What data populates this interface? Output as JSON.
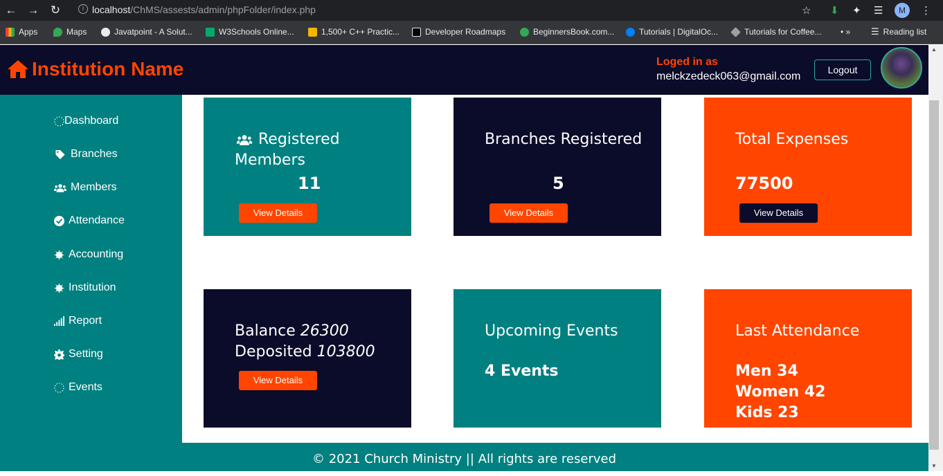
{
  "browser": {
    "url_host": "localhost",
    "url_path": "/ChMS/assests/admin/phpFolder/index.php",
    "reading_list": "Reading list",
    "profile_initial": "M",
    "bookmarks": [
      {
        "label": "Apps",
        "color": "#e8453c"
      },
      {
        "label": "Maps",
        "color": "#34a853"
      },
      {
        "label": "Javatpoint - A Solut...",
        "color": "#e8eaed"
      },
      {
        "label": "W3Schools Online...",
        "color": "#04aa6d"
      },
      {
        "label": "1,500+ C++ Practic...",
        "color": "#f4b400"
      },
      {
        "label": "Developer Roadmaps",
        "color": "#000000"
      },
      {
        "label": "BeginnersBook.com...",
        "color": "#34a853"
      },
      {
        "label": "Tutorials | DigitalOc...",
        "color": "#0080ff"
      },
      {
        "label": "Tutorials for Coffee...",
        "color": "#9aa0a6"
      }
    ]
  },
  "header": {
    "brand": "Institution Name",
    "logged_label": "Loged in as",
    "email": "melckzedeck063@gmail.com",
    "logout": "Logout"
  },
  "sidebar": {
    "items": [
      {
        "label": "Dashboard",
        "icon": "spinner-icon"
      },
      {
        "label": "Branches",
        "icon": "tags-icon"
      },
      {
        "label": "Members",
        "icon": "users-icon"
      },
      {
        "label": "Attendance",
        "icon": "check-circle-icon"
      },
      {
        "label": "Accounting",
        "icon": "sun-icon"
      },
      {
        "label": "Institution",
        "icon": "sun-icon"
      },
      {
        "label": "Report",
        "icon": "signal-icon"
      },
      {
        "label": "Setting",
        "icon": "gear-icon"
      },
      {
        "label": "Events",
        "icon": "spinner-icon"
      }
    ]
  },
  "cards": {
    "members": {
      "title_1": "Registered",
      "title_2": "Members",
      "value": "11",
      "button": "View Details"
    },
    "branches": {
      "title": "Branches Registered",
      "value": "5",
      "button": "View Details"
    },
    "expenses": {
      "title": "Total Expenses",
      "value": "77500",
      "button": "View Details"
    },
    "balance": {
      "balance_label": "Balance",
      "balance_value": "26300",
      "deposited_label": "Deposited",
      "deposited_value": "103800",
      "button": "View Details"
    },
    "events": {
      "title": "Upcoming Events",
      "value": "4 Events"
    },
    "attendance": {
      "title": "Last Attendance",
      "men": "Men 34",
      "women": "Women 42",
      "kids": "Kids 23"
    }
  },
  "footer": {
    "text": "© 2021 Church Ministry || All rights are reserved"
  },
  "colors": {
    "teal": "#008080",
    "navy": "#0b0b2a",
    "orange": "#ff4500"
  }
}
